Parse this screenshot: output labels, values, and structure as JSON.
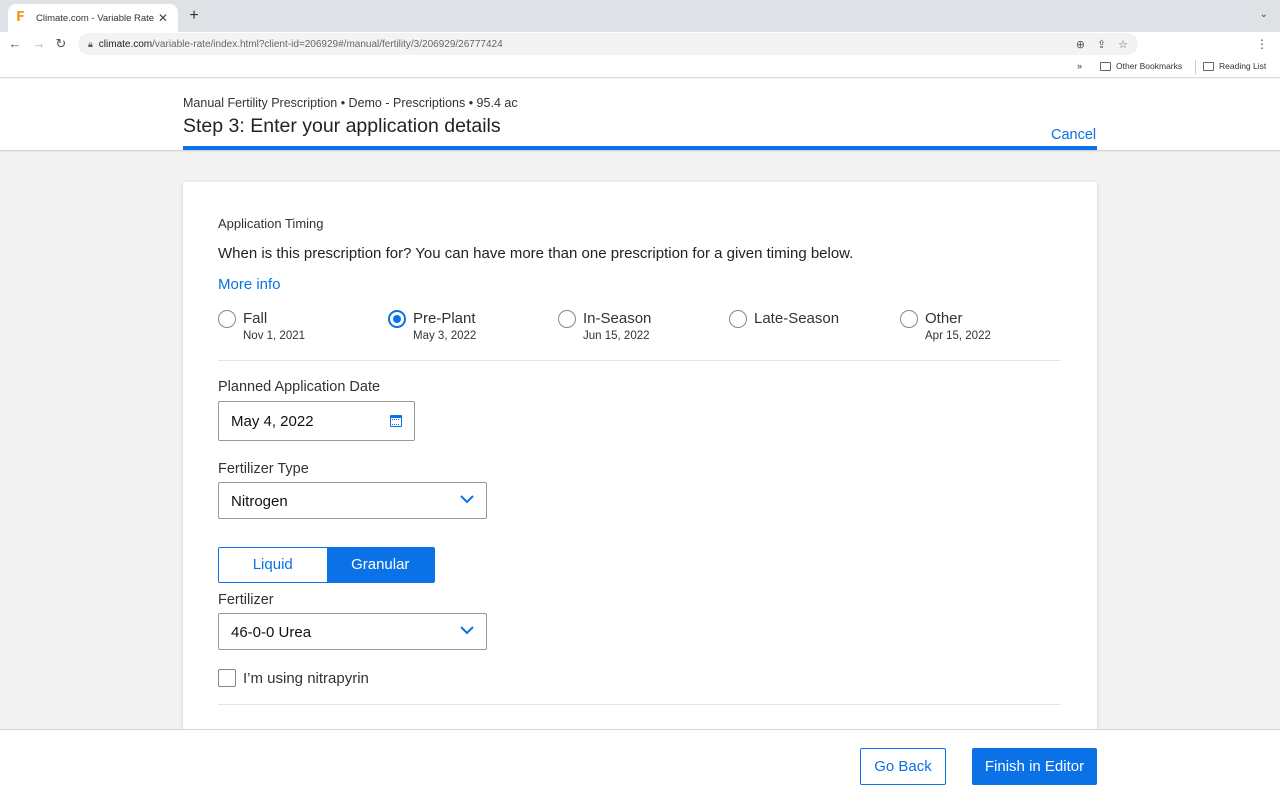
{
  "browser": {
    "tab_title": "Climate.com - Variable Rate",
    "favicon_glyph": "F",
    "tab_close": "✕",
    "new_tab": "+",
    "url_host": "climate.com",
    "url_path": "/variable-rate/index.html?client-id=206929#/manual/fertility/3/206929/26777424",
    "bookmarks_chevron": "»",
    "bookmarks": [
      {
        "label": "Other Bookmarks",
        "icon": "folder-icon"
      },
      {
        "label": "Reading List",
        "icon": "reading-list-icon"
      }
    ]
  },
  "header": {
    "subtitle": "Manual Fertility Prescription • Demo - Prescriptions • 95.4 ac",
    "step_title": "Step 3: Enter your application details",
    "cancel": "Cancel"
  },
  "timing": {
    "section_title": "Application Timing",
    "question": "When is this prescription for? You can have more than one prescription for a given timing below.",
    "more_info": "More info",
    "options": [
      {
        "label": "Fall",
        "date": "Nov 1, 2021",
        "checked": false
      },
      {
        "label": "Pre-Plant",
        "date": "May 3, 2022",
        "checked": true
      },
      {
        "label": "In-Season",
        "date": "Jun 15, 2022",
        "checked": false
      },
      {
        "label": "Late-Season",
        "date": "",
        "checked": false
      },
      {
        "label": "Other",
        "date": "Apr 15, 2022",
        "checked": false
      }
    ]
  },
  "planned_date": {
    "label": "Planned Application Date",
    "value": "May 4, 2022"
  },
  "fertilizer_type": {
    "label": "Fertilizer Type",
    "value": "Nitrogen"
  },
  "form_toggle": {
    "liquid": "Liquid",
    "granular": "Granular",
    "selected": "Granular"
  },
  "fertilizer": {
    "label": "Fertilizer",
    "value": "46-0-0 Urea"
  },
  "nitrapyrin": {
    "label": "I’m using nitrapyrin",
    "checked": false
  },
  "footer": {
    "go_back": "Go Back",
    "finish": "Finish in Editor"
  },
  "colors": {
    "accent": "#0a72e6",
    "background": "#f2f2f2"
  }
}
